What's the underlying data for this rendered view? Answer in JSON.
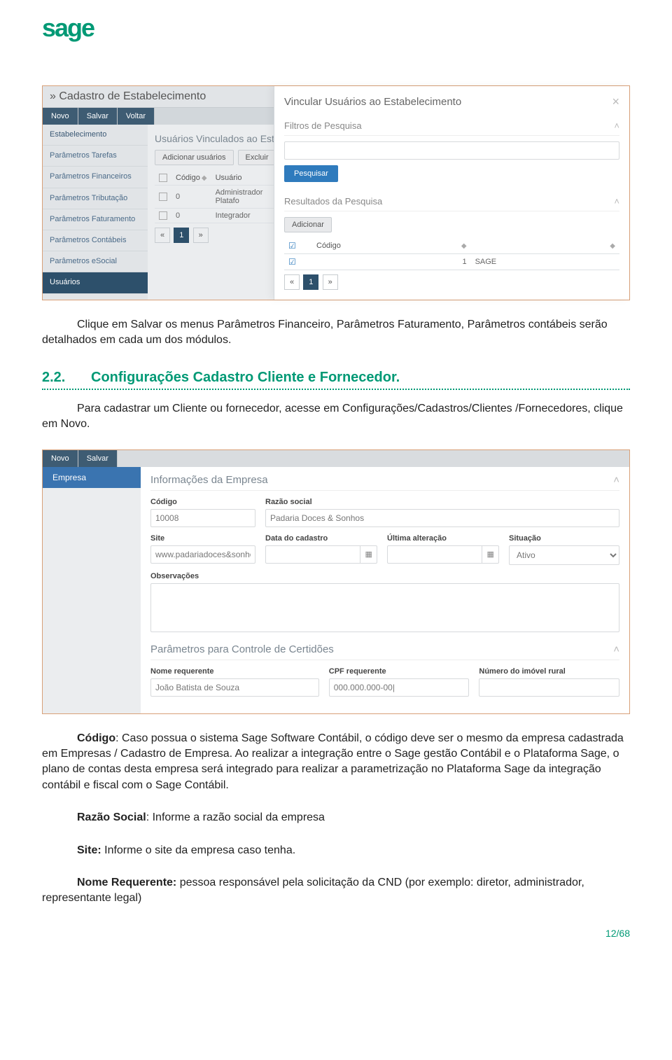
{
  "logo_text": "sage",
  "screenshot1": {
    "title": "Cadastro de Estabelecimento",
    "title_prefix": "»",
    "toolbar": [
      "Novo",
      "Salvar",
      "Voltar"
    ],
    "sidebar": [
      "Estabelecimento",
      "Parâmetros Tarefas",
      "Parâmetros Financeiros",
      "Parâmetros Tributação",
      "Parâmetros Faturamento",
      "Parâmetros Contábeis",
      "Parâmetros eSocial",
      "Usuários"
    ],
    "main_section": "Usuários Vinculados ao Estabel",
    "main_buttons": [
      "Adicionar usuários",
      "Excluir"
    ],
    "table": {
      "headers": [
        "",
        "Código",
        "Usuário"
      ],
      "rows": [
        [
          "",
          "0",
          "Administrador Platafo"
        ],
        [
          "",
          "0",
          "Integrador"
        ]
      ]
    },
    "pager": [
      "«",
      "1",
      "»"
    ],
    "modal": {
      "title": "Vincular Usuários ao Estabelecimento",
      "panel1": "Filtros de Pesquisa",
      "search_btn": "Pesquisar",
      "panel2": "Resultados da Pesquisa",
      "add_btn": "Adicionar",
      "results_headers": [
        "",
        "Código",
        ""
      ],
      "results_row": [
        "",
        "1",
        "SAGE"
      ],
      "pager": [
        "«",
        "1",
        "»"
      ]
    }
  },
  "body_para1": "Clique em Salvar os menus Parâmetros Financeiro, Parâmetros Faturamento, Parâmetros contábeis serão detalhados em cada um dos módulos.",
  "section": {
    "num": "2.2.",
    "title": "Configurações Cadastro Cliente e Fornecedor."
  },
  "body_para2": "Para cadastrar um Cliente ou fornecedor, acesse em Configurações/Cadastros/Clientes /Fornecedores, clique em Novo.",
  "screenshot2": {
    "toolbar": [
      "Novo",
      "Salvar"
    ],
    "side_tab": "Empresa",
    "section1": "Informações da Empresa",
    "fields": {
      "codigo_label": "Código",
      "codigo_value": "10008",
      "razao_label": "Razão social",
      "razao_value": "Padaria Doces & Sonhos",
      "site_label": "Site",
      "site_value": "www.padariadoces&sonhos.com",
      "data_cad_label": "Data do cadastro",
      "ult_alt_label": "Última alteração",
      "sit_label": "Situação",
      "sit_value": "Ativo",
      "obs_label": "Observações"
    },
    "section2": "Parâmetros para Controle de Certidões",
    "fields2": {
      "nome_req_label": "Nome requerente",
      "nome_req_value": "João Batista de Souza",
      "cpf_req_label": "CPF requerente",
      "cpf_req_value": "000.000.000-00|",
      "num_imovel_label": "Número do imóvel rural"
    }
  },
  "body_para3_lead": "Código",
  "body_para3": ": Caso possua o sistema Sage Software Contábil, o código deve ser o mesmo da empresa cadastrada em Empresas / Cadastro de Empresa. Ao realizar a integração entre o Sage gestão Contábil e o Plataforma Sage, o plano de contas desta empresa será integrado para realizar a parametrização no Plataforma Sage da integração contábil e fiscal com o Sage Contábil.",
  "body_para4_lead": "Razão Social",
  "body_para4": ": Informe a razão social da empresa",
  "body_para5_lead": "Site:",
  "body_para5": " Informe o site da empresa caso tenha.",
  "body_para6_lead": "Nome Requerente:",
  "body_para6": " pessoa responsável pela solicitação da CND (por exemplo: diretor, administrador, representante legal)",
  "page_footer": "12/68"
}
